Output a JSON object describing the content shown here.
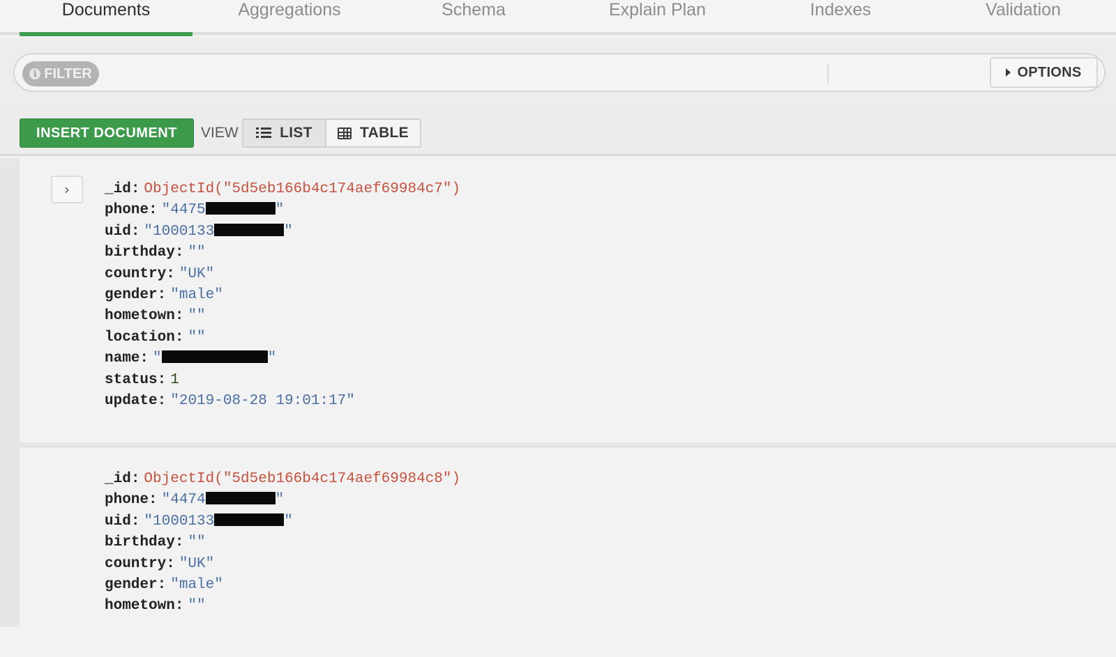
{
  "tabs": [
    {
      "label": "Documents",
      "active": true
    },
    {
      "label": "Aggregations",
      "active": false
    },
    {
      "label": "Schema",
      "active": false
    },
    {
      "label": "Explain Plan",
      "active": false
    },
    {
      "label": "Indexes",
      "active": false
    },
    {
      "label": "Validation",
      "active": false
    }
  ],
  "filter": {
    "pill_label": "FILTER",
    "info_icon": "i",
    "value": "",
    "options_label": "OPTIONS"
  },
  "toolbar": {
    "insert_label": "INSERT DOCUMENT",
    "view_label": "VIEW",
    "list_label": "LIST",
    "table_label": "TABLE",
    "active_view": "LIST"
  },
  "expand_glyph": "›",
  "documents": [
    {
      "id_key": "_id",
      "id_value": "ObjectId(\"5d5eb166b4c174aef69984c7\")",
      "phone_key": "phone",
      "phone_visible": "\"4475",
      "phone_end": "\"",
      "uid_key": "uid",
      "uid_visible": "\"1000133",
      "uid_end": "\"",
      "birthday_key": "birthday",
      "birthday_value": "\"\"",
      "country_key": "country",
      "country_value": "\"UK\"",
      "gender_key": "gender",
      "gender_value": "\"male\"",
      "hometown_key": "hometown",
      "hometown_value": "\"\"",
      "location_key": "location",
      "location_value": "\"\"",
      "name_key": "name",
      "name_start": "\"",
      "name_end": "\"",
      "status_key": "status",
      "status_value": "1",
      "update_key": "update",
      "update_value": "\"2019-08-28 19:01:17\""
    },
    {
      "id_key": "_id",
      "id_value": "ObjectId(\"5d5eb166b4c174aef69984c8\")",
      "phone_key": "phone",
      "phone_visible": "\"4474",
      "phone_end": "\"",
      "uid_key": "uid",
      "uid_visible": "\"1000133",
      "uid_end": "\"",
      "birthday_key": "birthday",
      "birthday_value": "\"\"",
      "country_key": "country",
      "country_value": "\"UK\"",
      "gender_key": "gender",
      "gender_value": "\"male\"",
      "hometown_key": "hometown",
      "hometown_value": "\"\""
    }
  ],
  "colors": {
    "accent_green": "#3c9a4b",
    "objectid": "#c9523e",
    "string": "#4a6fa3"
  }
}
